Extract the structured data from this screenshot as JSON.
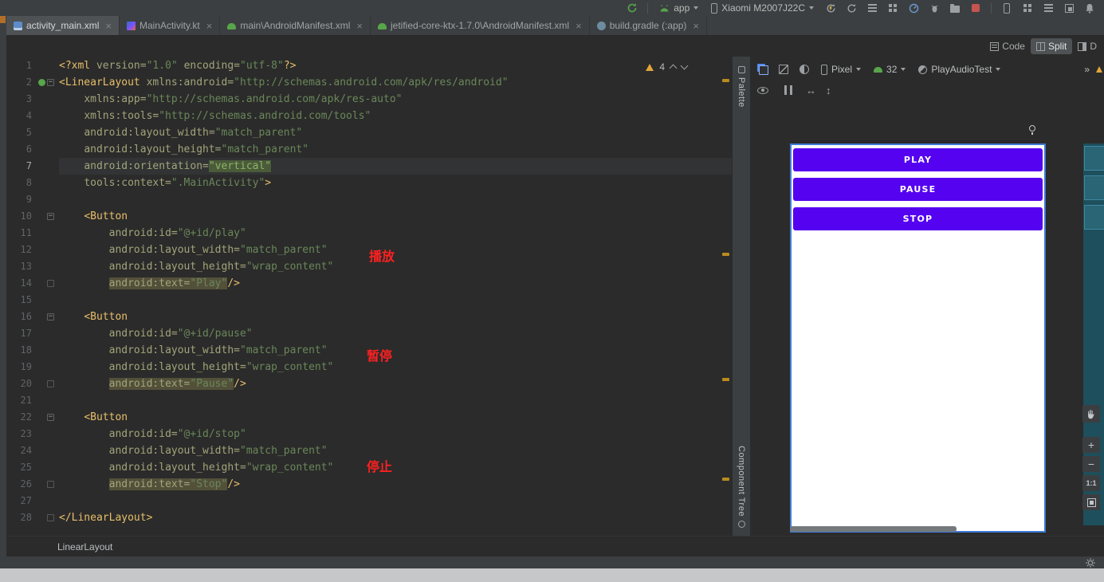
{
  "top_toolbar": {
    "run_config": "app",
    "device_name": "Xiaomi M2007J22C"
  },
  "editor_tabs": [
    {
      "label": "activity_main.xml",
      "icon": "layout-file",
      "active": true
    },
    {
      "label": "MainActivity.kt",
      "icon": "kotlin-file",
      "active": false
    },
    {
      "label": "main\\AndroidManifest.xml",
      "icon": "manifest-file",
      "active": false
    },
    {
      "label": "jetified-core-ktx-1.7.0\\AndroidManifest.xml",
      "icon": "manifest-file",
      "active": false
    },
    {
      "label": "build.gradle (:app)",
      "icon": "gradle-file",
      "active": false
    }
  ],
  "view_modes": {
    "code": "Code",
    "split": "Split",
    "design": "D"
  },
  "inspection": {
    "warning_count": "4"
  },
  "code": {
    "lines": [
      {
        "n": 1,
        "s": [
          [
            "<?xml ",
            "t"
          ],
          [
            "version=",
            "a"
          ],
          [
            "\"1.0\"",
            "v"
          ],
          [
            " ",
            "p"
          ],
          [
            "encoding=",
            "a"
          ],
          [
            "\"utf-8\"",
            "v"
          ],
          [
            "?>",
            "t"
          ]
        ]
      },
      {
        "n": 2,
        "icon": "android",
        "fold": "start",
        "s": [
          [
            "<LinearLayout ",
            "t"
          ],
          [
            "xmlns:android=",
            "a"
          ],
          [
            "\"http://schemas.android.com/apk/res/android\"",
            "v"
          ]
        ]
      },
      {
        "n": 3,
        "s": [
          [
            "    ",
            "p"
          ],
          [
            "xmlns:app=",
            "a"
          ],
          [
            "\"http://schemas.android.com/apk/res-auto\"",
            "v"
          ]
        ]
      },
      {
        "n": 4,
        "s": [
          [
            "    ",
            "p"
          ],
          [
            "xmlns:tools=",
            "a"
          ],
          [
            "\"http://schemas.android.com/tools\"",
            "v"
          ]
        ]
      },
      {
        "n": 5,
        "s": [
          [
            "    ",
            "p"
          ],
          [
            "android:layout_width=",
            "a"
          ],
          [
            "\"match_parent\"",
            "v"
          ]
        ]
      },
      {
        "n": 6,
        "s": [
          [
            "    ",
            "p"
          ],
          [
            "android:layout_height=",
            "a"
          ],
          [
            "\"match_parent\"",
            "v"
          ]
        ]
      },
      {
        "n": 7,
        "caret": true,
        "s": [
          [
            "    ",
            "p"
          ],
          [
            "android:orientation=",
            "a"
          ],
          [
            "\"vertical\"",
            "v sel"
          ]
        ]
      },
      {
        "n": 8,
        "s": [
          [
            "    ",
            "p"
          ],
          [
            "tools:context=",
            "a"
          ],
          [
            "\".MainActivity\"",
            "v"
          ],
          [
            ">",
            "t"
          ]
        ]
      },
      {
        "n": 9,
        "s": []
      },
      {
        "n": 10,
        "fold": "start",
        "s": [
          [
            "    ",
            "p"
          ],
          [
            "<Button",
            "t"
          ]
        ]
      },
      {
        "n": 11,
        "s": [
          [
            "        ",
            "p"
          ],
          [
            "android:id=",
            "a"
          ],
          [
            "\"@+id/play\"",
            "v"
          ]
        ]
      },
      {
        "n": 12,
        "s": [
          [
            "        ",
            "p"
          ],
          [
            "android:layout_width=",
            "a"
          ],
          [
            "\"match_parent\"",
            "v"
          ]
        ]
      },
      {
        "n": 13,
        "s": [
          [
            "        ",
            "p"
          ],
          [
            "android:layout_height=",
            "a"
          ],
          [
            "\"wrap_content\"",
            "v"
          ]
        ]
      },
      {
        "n": 14,
        "fold": "end",
        "s": [
          [
            "        ",
            "p"
          ],
          [
            "android:text=",
            "a hl"
          ],
          [
            "\"Play\"",
            "v hl"
          ],
          [
            "/>",
            "t"
          ]
        ]
      },
      {
        "n": 15,
        "s": []
      },
      {
        "n": 16,
        "fold": "start",
        "s": [
          [
            "    ",
            "p"
          ],
          [
            "<Button",
            "t"
          ]
        ]
      },
      {
        "n": 17,
        "s": [
          [
            "        ",
            "p"
          ],
          [
            "android:id=",
            "a"
          ],
          [
            "\"@+id/pause\"",
            "v"
          ]
        ]
      },
      {
        "n": 18,
        "s": [
          [
            "        ",
            "p"
          ],
          [
            "android:layout_width=",
            "a"
          ],
          [
            "\"match_parent\"",
            "v"
          ]
        ]
      },
      {
        "n": 19,
        "s": [
          [
            "        ",
            "p"
          ],
          [
            "android:layout_height=",
            "a"
          ],
          [
            "\"wrap_content\"",
            "v"
          ]
        ]
      },
      {
        "n": 20,
        "fold": "end",
        "s": [
          [
            "        ",
            "p"
          ],
          [
            "android:text=",
            "a hl"
          ],
          [
            "\"Pause\"",
            "v hl"
          ],
          [
            "/>",
            "t"
          ]
        ]
      },
      {
        "n": 21,
        "s": []
      },
      {
        "n": 22,
        "fold": "start",
        "s": [
          [
            "    ",
            "p"
          ],
          [
            "<Button",
            "t"
          ]
        ]
      },
      {
        "n": 23,
        "s": [
          [
            "        ",
            "p"
          ],
          [
            "android:id=",
            "a"
          ],
          [
            "\"@+id/stop\"",
            "v"
          ]
        ]
      },
      {
        "n": 24,
        "s": [
          [
            "        ",
            "p"
          ],
          [
            "android:layout_width=",
            "a"
          ],
          [
            "\"match_parent\"",
            "v"
          ]
        ]
      },
      {
        "n": 25,
        "s": [
          [
            "        ",
            "p"
          ],
          [
            "android:layout_height=",
            "a"
          ],
          [
            "\"wrap_content\"",
            "v"
          ]
        ]
      },
      {
        "n": 26,
        "fold": "end",
        "s": [
          [
            "        ",
            "p"
          ],
          [
            "android:text=",
            "a hl"
          ],
          [
            "\"Stop\"",
            "v hl"
          ],
          [
            "/>",
            "t"
          ]
        ]
      },
      {
        "n": 27,
        "s": []
      },
      {
        "n": 28,
        "fold": "end",
        "s": [
          [
            "</LinearLayout>",
            "t"
          ]
        ]
      }
    ]
  },
  "annotations": {
    "play": "播放",
    "pause": "暂停",
    "stop": "停止"
  },
  "side_rail": {
    "palette": "Palette",
    "component_tree": "Component Tree"
  },
  "design": {
    "device": "Pixel",
    "api_level": "32",
    "theme": "PlayAudioTest",
    "overflow": "»",
    "preview_buttons": [
      "PLAY",
      "PAUSE",
      "STOP"
    ],
    "zoom_ratio": "1:1"
  },
  "status_bar": {
    "breadcrumb": "LinearLayout"
  },
  "colors": {
    "button_purple": "#5502f0",
    "annotation_red": "#fe2020",
    "blueprint_teal": "#1e4f5c",
    "warning_stripe": "#b98b1e",
    "selection_green": "#4a5b3a"
  }
}
